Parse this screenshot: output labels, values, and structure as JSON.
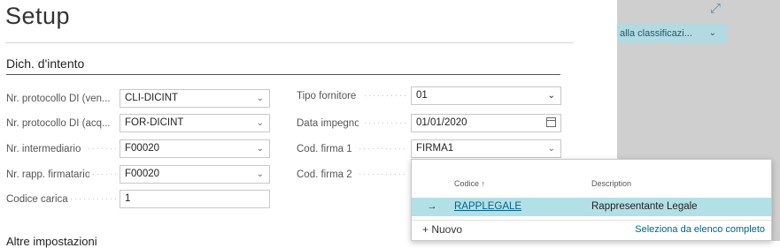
{
  "page": {
    "title": "Setup"
  },
  "background": {
    "dropdown_label": "alla classificazi...",
    "dropdown_chevron": "⌄",
    "expand_icon": "⤢"
  },
  "section": {
    "title": "Dich. d'intento"
  },
  "left_fields": [
    {
      "label": "Nr. protocollo DI (ven...",
      "value": "CLI-DICINT",
      "type": "select"
    },
    {
      "label": "Nr. protocollo DI (acq...",
      "value": "FOR-DICINT",
      "type": "select"
    },
    {
      "label": "Nr. intermediario",
      "value": "F00020",
      "type": "select"
    },
    {
      "label": "Nr. rapp. firmatario",
      "value": "F00020",
      "type": "select"
    },
    {
      "label": "Codice carica",
      "value": "1",
      "type": "text"
    }
  ],
  "right_fields": [
    {
      "label": "Tipo fornitore",
      "value": "01",
      "type": "select"
    },
    {
      "label": "Data impegno",
      "value": "01/01/2020",
      "type": "date"
    },
    {
      "label": "Cod. firma 1",
      "value": "FIRMA1",
      "type": "select"
    },
    {
      "label": "Cod. firma 2",
      "value": "",
      "type": "select"
    }
  ],
  "chevron": "⌄",
  "cut_heading": "Altre impostazioni",
  "lookup": {
    "col_code": "Codice ↑",
    "col_desc": "Description",
    "rows": [
      {
        "arrow": "→",
        "code": "RAPPLEGALE",
        "description": "Rappresentante Legale"
      }
    ],
    "new_label": "+ Nuovo",
    "full_list_label": "Seleziona da elenco completo"
  }
}
